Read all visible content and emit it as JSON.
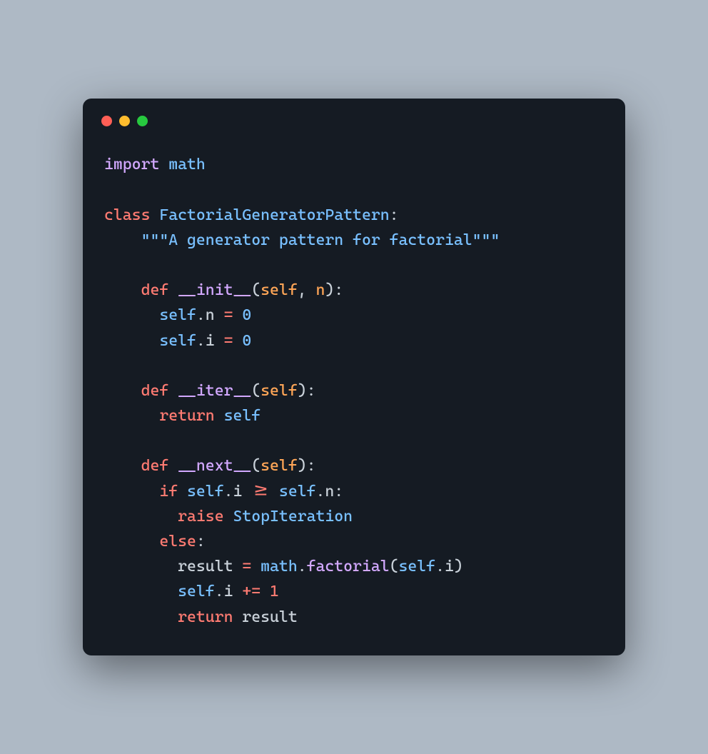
{
  "window": {
    "traffic_lights": [
      "close",
      "minimize",
      "zoom"
    ]
  },
  "code": {
    "lines": [
      {
        "tokens": [
          [
            "kw-import",
            "import"
          ],
          [
            "punct",
            " "
          ],
          [
            "kw-module",
            "math"
          ]
        ]
      },
      {
        "tokens": []
      },
      {
        "tokens": [
          [
            "kw-class",
            "class"
          ],
          [
            "punct",
            " "
          ],
          [
            "classname",
            "FactorialGeneratorPattern"
          ],
          [
            "punct",
            ":"
          ]
        ]
      },
      {
        "tokens": [
          [
            "punct",
            "    "
          ],
          [
            "docstring",
            "\"\"\"A generator pattern for factorial\"\"\""
          ]
        ]
      },
      {
        "tokens": []
      },
      {
        "tokens": [
          [
            "punct",
            "    "
          ],
          [
            "kw-def",
            "def"
          ],
          [
            "punct",
            " "
          ],
          [
            "fname",
            "__init__"
          ],
          [
            "punct",
            "("
          ],
          [
            "param",
            "self"
          ],
          [
            "punct",
            ", "
          ],
          [
            "param",
            "n"
          ],
          [
            "punct",
            "):"
          ]
        ]
      },
      {
        "tokens": [
          [
            "punct",
            "      "
          ],
          [
            "self-ref",
            "self"
          ],
          [
            "dot-access",
            "."
          ],
          [
            "ident",
            "n"
          ],
          [
            "punct",
            " "
          ],
          [
            "op",
            "="
          ],
          [
            "punct",
            " "
          ],
          [
            "zero",
            "0"
          ]
        ]
      },
      {
        "tokens": [
          [
            "punct",
            "      "
          ],
          [
            "self-ref",
            "self"
          ],
          [
            "dot-access",
            "."
          ],
          [
            "ident",
            "i"
          ],
          [
            "punct",
            " "
          ],
          [
            "op",
            "="
          ],
          [
            "punct",
            " "
          ],
          [
            "zero",
            "0"
          ]
        ]
      },
      {
        "tokens": []
      },
      {
        "tokens": [
          [
            "punct",
            "    "
          ],
          [
            "kw-def",
            "def"
          ],
          [
            "punct",
            " "
          ],
          [
            "fname",
            "__iter__"
          ],
          [
            "punct",
            "("
          ],
          [
            "param",
            "self"
          ],
          [
            "punct",
            "):"
          ]
        ]
      },
      {
        "tokens": [
          [
            "punct",
            "      "
          ],
          [
            "kw-return",
            "return"
          ],
          [
            "punct",
            " "
          ],
          [
            "self-ref",
            "self"
          ]
        ]
      },
      {
        "tokens": []
      },
      {
        "tokens": [
          [
            "punct",
            "    "
          ],
          [
            "kw-def",
            "def"
          ],
          [
            "punct",
            " "
          ],
          [
            "fname",
            "__next__"
          ],
          [
            "punct",
            "("
          ],
          [
            "param",
            "self"
          ],
          [
            "punct",
            "):"
          ]
        ]
      },
      {
        "tokens": [
          [
            "punct",
            "      "
          ],
          [
            "kw-if",
            "if"
          ],
          [
            "punct",
            " "
          ],
          [
            "self-ref",
            "self"
          ],
          [
            "dot-access",
            "."
          ],
          [
            "ident",
            "i"
          ],
          [
            "punct",
            " "
          ],
          [
            "op",
            ">="
          ],
          [
            "punct",
            " "
          ],
          [
            "self-ref",
            "self"
          ],
          [
            "dot-access",
            "."
          ],
          [
            "ident",
            "n"
          ],
          [
            "punct",
            ":"
          ]
        ]
      },
      {
        "tokens": [
          [
            "punct",
            "        "
          ],
          [
            "kw-raise",
            "raise"
          ],
          [
            "punct",
            " "
          ],
          [
            "classname",
            "StopIteration"
          ]
        ]
      },
      {
        "tokens": [
          [
            "punct",
            "      "
          ],
          [
            "kw-else",
            "else"
          ],
          [
            "punct",
            ":"
          ]
        ]
      },
      {
        "tokens": [
          [
            "punct",
            "        "
          ],
          [
            "ident",
            "result"
          ],
          [
            "punct",
            " "
          ],
          [
            "op",
            "="
          ],
          [
            "punct",
            " "
          ],
          [
            "obj",
            "math"
          ],
          [
            "dot-access",
            "."
          ],
          [
            "fname",
            "factorial"
          ],
          [
            "punct",
            "("
          ],
          [
            "self-ref",
            "self"
          ],
          [
            "dot-access",
            "."
          ],
          [
            "ident",
            "i"
          ],
          [
            "punct",
            ")"
          ]
        ]
      },
      {
        "tokens": [
          [
            "punct",
            "        "
          ],
          [
            "self-ref",
            "self"
          ],
          [
            "dot-access",
            "."
          ],
          [
            "ident",
            "i"
          ],
          [
            "punct",
            " "
          ],
          [
            "op",
            "+="
          ],
          [
            "punct",
            " "
          ],
          [
            "one",
            "1"
          ]
        ]
      },
      {
        "tokens": [
          [
            "punct",
            "        "
          ],
          [
            "kw-return",
            "return"
          ],
          [
            "punct",
            " "
          ],
          [
            "ident",
            "result"
          ]
        ]
      }
    ]
  }
}
